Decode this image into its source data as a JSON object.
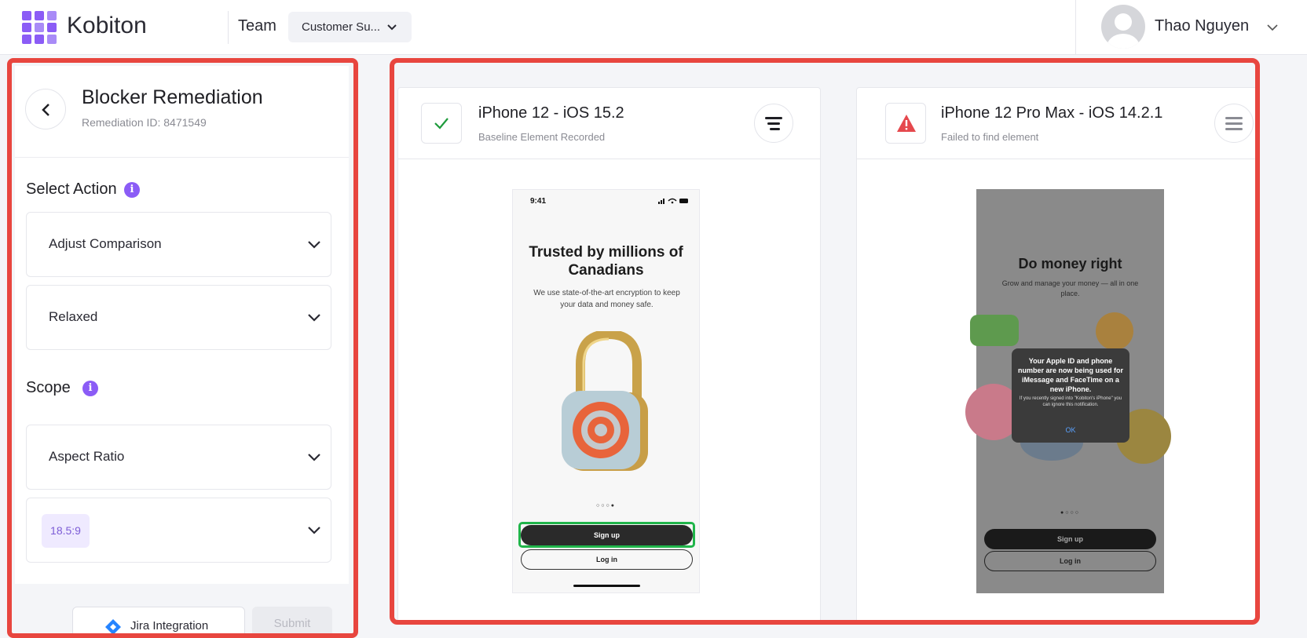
{
  "topbar": {
    "brand": "Kobiton",
    "team_label": "Team",
    "team_value": "Customer Su...",
    "user_name": "Thao Nguyen"
  },
  "panel": {
    "title": "Blocker Remediation",
    "remediation_id": "Remediation ID: 8471549",
    "select_action_label": "Select Action",
    "action_dropdown": "Adjust Comparison",
    "mode_dropdown": "Relaxed",
    "scope_label": "Scope",
    "scope_dropdown": "Aspect Ratio",
    "ratio_chip": "18.5:9",
    "jira_button": "Jira Integration",
    "submit_button": "Submit"
  },
  "devices": [
    {
      "name": "iPhone 12 - iOS 15.2",
      "status": "Baseline Element Recorded",
      "status_icon": "check-icon",
      "screen": {
        "time": "9:41",
        "title": "Trusted by millions of Canadians",
        "description": "We use state-of-the-art encryption to keep your data and money safe.",
        "dots": "○○○●",
        "signup": "Sign up",
        "login": "Log in"
      }
    },
    {
      "name": "iPhone 12 Pro Max - iOS 14.2.1",
      "status": "Failed to find element",
      "status_icon": "warning-icon",
      "screen": {
        "title": "Do money right",
        "description": "Grow and manage your money — all in one place.",
        "alert_title": "Your Apple ID and phone number are now being used for iMessage and FaceTime on a new iPhone.",
        "alert_body": "If you recently signed into \"Kobiton's iPhone\" you can ignore this notification.",
        "alert_ok": "OK",
        "dots": "●○○○",
        "signup": "Sign up",
        "login": "Log in"
      }
    }
  ],
  "colors": {
    "accent": "#8b5cf6",
    "highlight_red": "#e8463f",
    "success_green": "#20b54a",
    "warning_red": "#e5484d"
  }
}
